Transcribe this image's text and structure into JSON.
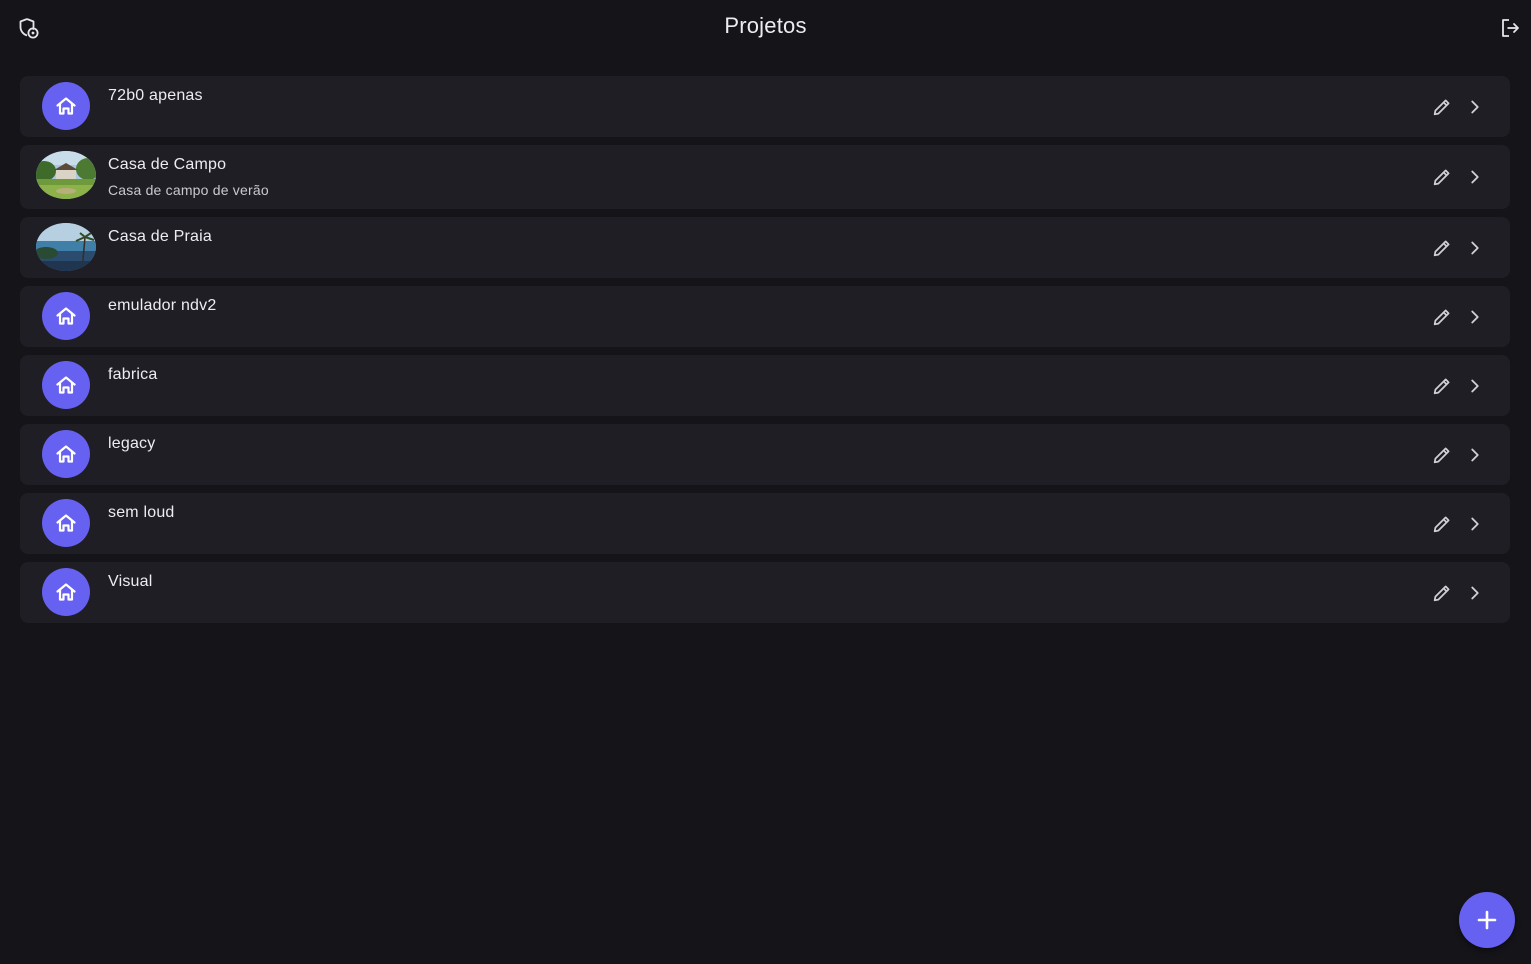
{
  "header": {
    "title": "Projetos",
    "left_icon": "shield-settings-icon",
    "right_icon": "logout-icon"
  },
  "theme": {
    "background": "#151419",
    "card": "#1f1e24",
    "accent": "#6661f0"
  },
  "projects": [
    {
      "name": "72b0 apenas",
      "subtitle": "",
      "avatar": "home-icon"
    },
    {
      "name": "Casa de Campo",
      "subtitle": "Casa de campo de verão",
      "avatar": "photo-countryside"
    },
    {
      "name": "Casa de Praia",
      "subtitle": "",
      "avatar": "photo-beach"
    },
    {
      "name": "emulador ndv2",
      "subtitle": "",
      "avatar": "home-icon"
    },
    {
      "name": "fabrica",
      "subtitle": "",
      "avatar": "home-icon"
    },
    {
      "name": "legacy",
      "subtitle": "",
      "avatar": "home-icon"
    },
    {
      "name": "sem loud",
      "subtitle": "",
      "avatar": "home-icon"
    },
    {
      "name": "Visual",
      "subtitle": "",
      "avatar": "home-icon"
    }
  ],
  "fab": {
    "icon": "plus-icon"
  }
}
